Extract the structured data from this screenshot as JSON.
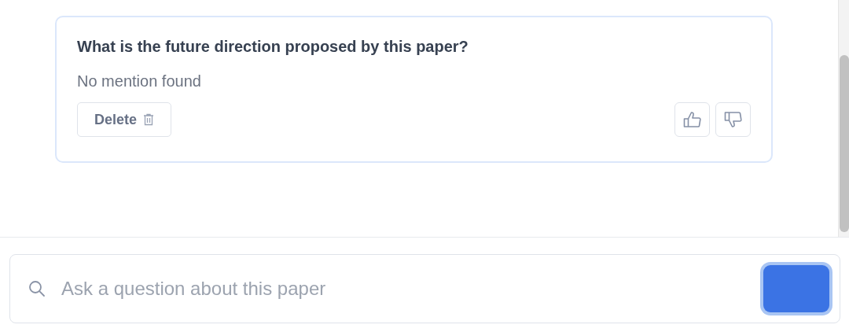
{
  "card": {
    "question": "What is the future direction proposed by this paper?",
    "answer": "No mention found",
    "delete_label": "Delete"
  },
  "search": {
    "placeholder": "Ask a question about this paper"
  }
}
